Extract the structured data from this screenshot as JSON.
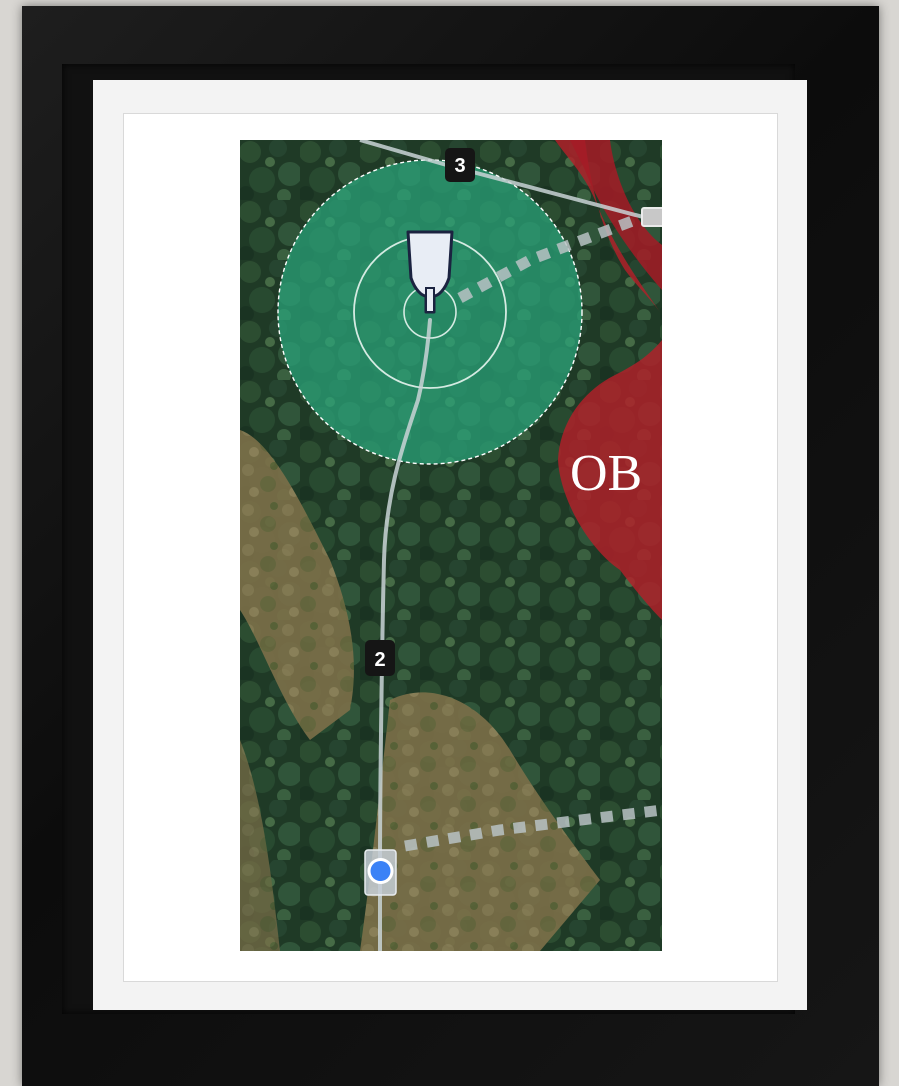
{
  "map": {
    "ob_label": "OB",
    "waypoints": [
      {
        "label": "3"
      },
      {
        "label": "2"
      }
    ],
    "icons": {
      "basket": "disc-golf-basket-icon",
      "user_location": "user-location-icon"
    },
    "colors": {
      "target_zone": "#2aa57c",
      "ob_zone": "#b3202a",
      "path": "#c9d3d6",
      "badge_bg": "#151515",
      "location_dot": "#3b82f6",
      "basket_fill": "#e8edf5",
      "basket_stroke": "#1b2340"
    }
  }
}
